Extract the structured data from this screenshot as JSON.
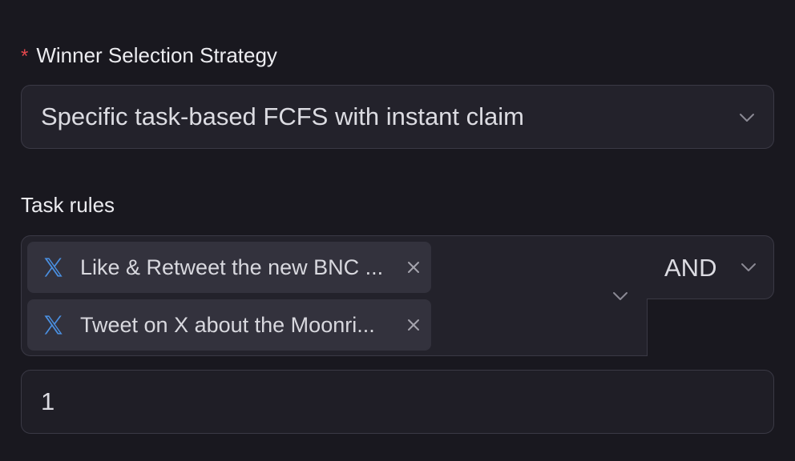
{
  "strategy": {
    "required_mark": "*",
    "label": "Winner Selection Strategy",
    "selected_value": "Specific task-based FCFS with instant claim"
  },
  "task_rules": {
    "label": "Task rules",
    "tags": [
      {
        "icon": "x-logo-icon",
        "text": "Like & Retweet the new BNC ..."
      },
      {
        "icon": "x-logo-icon",
        "text": "Tweet on X about the Moonri..."
      }
    ],
    "operator": "AND"
  },
  "count_input": {
    "value": "1"
  },
  "colors": {
    "background": "#19181f",
    "field": "#23222b",
    "border": "#3a3945",
    "tag": "#33323d",
    "required": "#e5484d",
    "x_icon": "#4a90e2"
  }
}
